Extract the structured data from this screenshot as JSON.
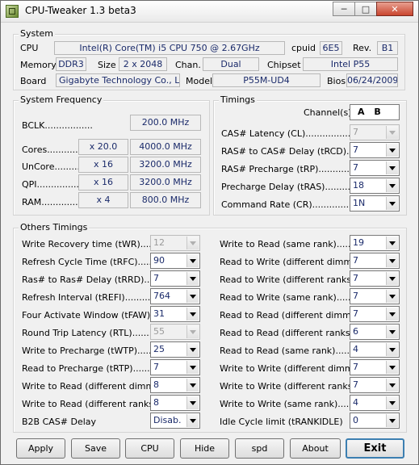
{
  "window": {
    "title": "CPU-Tweaker 1.3 beta3"
  },
  "system": {
    "legend": "System",
    "cpu_label": "CPU",
    "cpu_value": "Intel(R) Core(TM) i5 CPU        750  @ 2.67GHz",
    "cpuid_label": "cpuid",
    "cpuid_value": "6E5",
    "rev_label": "Rev.",
    "rev_value": "B1",
    "memory_label": "Memory",
    "memory_value": "DDR3",
    "size_label": "Size",
    "size_value": "2 x 2048",
    "chan_label": "Chan.",
    "chan_value": "Dual",
    "chipset_label": "Chipset",
    "chipset_value": "Intel P55",
    "board_label": "Board",
    "board_value": "Gigabyte Technology Co., Ltd.",
    "model_label": "Model",
    "model_value": "P55M-UD4",
    "bios_label": "Bios",
    "bios_value": "06/24/2009"
  },
  "frequency": {
    "legend": "System Frequency",
    "bclk_label": "BCLK.................",
    "bclk_value": "200.0 MHz",
    "rows": [
      {
        "label": "Cores...............",
        "mult": "x 20.0",
        "value": "4000.0 MHz"
      },
      {
        "label": "UnCore............",
        "mult": "x 16",
        "value": "3200.0 MHz"
      },
      {
        "label": "QPI..................",
        "mult": "x 16",
        "value": "3200.0 MHz"
      },
      {
        "label": "RAM................",
        "mult": "x 4",
        "value": "800.0 MHz"
      }
    ]
  },
  "timings": {
    "legend": "Timings",
    "channel_label": "Channel(s)",
    "channel_value": "A  B",
    "rows": [
      {
        "label": "CAS# Latency (CL)...................",
        "value": "7"
      },
      {
        "label": "RAS# to CAS# Delay (tRCD).........",
        "value": "7"
      },
      {
        "label": "RAS# Precharge (tRP)...............",
        "value": "7"
      },
      {
        "label": "Precharge Delay (tRAS)............",
        "value": "18"
      },
      {
        "label": "Command Rate (CR)..................",
        "value": "1N"
      }
    ]
  },
  "others": {
    "legend": "Others Timings",
    "left": [
      {
        "label": "Write Recovery time (tWR)............",
        "value": "12"
      },
      {
        "label": "Refresh Cycle Time (tRFC)..........",
        "value": "90"
      },
      {
        "label": "Ras# to Ras# Delay (tRRD)..........",
        "value": "7"
      },
      {
        "label": "Refresh Interval (tREFI)..............",
        "value": "764"
      },
      {
        "label": "Four Activate Window (tFAW).......",
        "value": "31"
      },
      {
        "label": "Round Trip Latency (RTL)...........",
        "value": "55"
      },
      {
        "label": "Write to Precharge (tWTP)..........",
        "value": "25"
      },
      {
        "label": "Read to Precharge (tRTP)...........",
        "value": "7"
      },
      {
        "label": "Write to Read (different dimms)....",
        "value": "8"
      },
      {
        "label": "Write to Read (different ranks)....",
        "value": "8"
      },
      {
        "label": "B2B CAS# Delay",
        "value": "Disab."
      }
    ],
    "right": [
      {
        "label": "Write to Read (same rank)..............",
        "value": "19"
      },
      {
        "label": "Read to Write (different dimms).......",
        "value": "7"
      },
      {
        "label": "Read to Write (different ranks).......",
        "value": "7"
      },
      {
        "label": "Read to Write (same rank)..............",
        "value": "7"
      },
      {
        "label": "Read to Read (different dimms).......",
        "value": "7"
      },
      {
        "label": "Read to Read (different ranks).......",
        "value": "6"
      },
      {
        "label": "Read to Read (same rank)...............",
        "value": "4"
      },
      {
        "label": "Write to Write (different dimms)......",
        "value": "7"
      },
      {
        "label": "Write to Write (different ranks)......",
        "value": "7"
      },
      {
        "label": "Write to Write (same rank).............",
        "value": "4"
      },
      {
        "label": "Idle Cycle limit (tRANKIDLE)",
        "value": "0"
      }
    ]
  },
  "buttons": {
    "apply": "Apply",
    "save": "Save",
    "cpu": "CPU",
    "hide": "Hide",
    "spd": "spd",
    "about": "About",
    "exit": "Exit"
  }
}
